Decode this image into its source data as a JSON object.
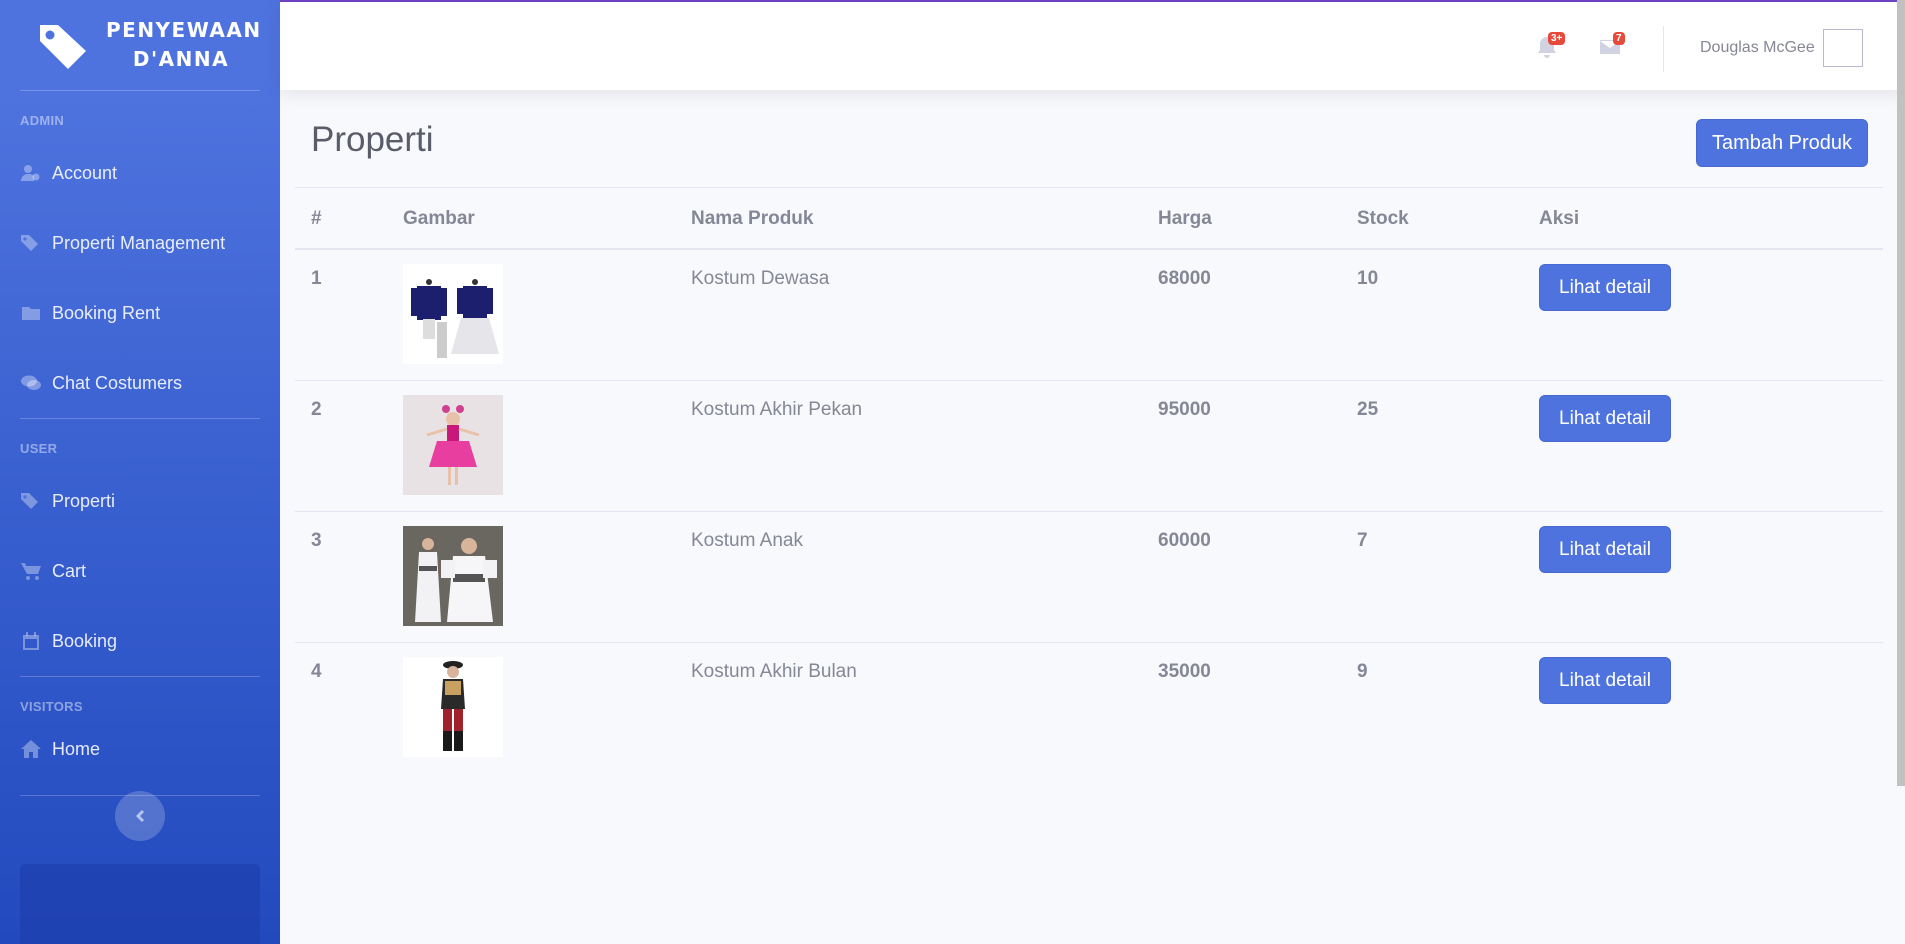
{
  "sidebar": {
    "brand_line1": "PENYEWAAN",
    "brand_line2": "D'ANNA",
    "sections": [
      {
        "heading": "ADMIN",
        "items": [
          {
            "label": "Account",
            "icon": "user-cog-icon"
          },
          {
            "label": "Properti Management",
            "icon": "tags-icon"
          },
          {
            "label": "Booking Rent",
            "icon": "folder-icon"
          },
          {
            "label": "Chat Costumers",
            "icon": "comments-icon"
          }
        ]
      },
      {
        "heading": "USER",
        "items": [
          {
            "label": "Properti",
            "icon": "tags-icon"
          },
          {
            "label": "Cart",
            "icon": "cart-icon"
          },
          {
            "label": "Booking",
            "icon": "calendar-icon"
          }
        ]
      },
      {
        "heading": "VISITORS",
        "items": [
          {
            "label": "Home",
            "icon": "home-icon"
          }
        ]
      }
    ]
  },
  "topbar": {
    "alerts_badge": "3+",
    "messages_badge": "7",
    "user_name": "Douglas McGee"
  },
  "main": {
    "title": "Properti",
    "add_button": "Tambah Produk",
    "columns": [
      "#",
      "Gambar",
      "Nama Produk",
      "Harga",
      "Stock",
      "Aksi"
    ],
    "rows": [
      {
        "no": "1",
        "name": "Kostum Dewasa",
        "price": "68000",
        "stock": "10",
        "action": "Lihat detail"
      },
      {
        "no": "2",
        "name": "Kostum Akhir Pekan",
        "price": "95000",
        "stock": "25",
        "action": "Lihat detail"
      },
      {
        "no": "3",
        "name": "Kostum Anak",
        "price": "60000",
        "stock": "7",
        "action": "Lihat detail"
      },
      {
        "no": "4",
        "name": "Kostum Akhir Bulan",
        "price": "35000",
        "stock": "9",
        "action": "Lihat detail"
      }
    ]
  },
  "colors": {
    "primary": "#4e73df",
    "sidebar_dark": "#224abe",
    "text_muted": "#858796",
    "badge": "#e74a3b"
  }
}
